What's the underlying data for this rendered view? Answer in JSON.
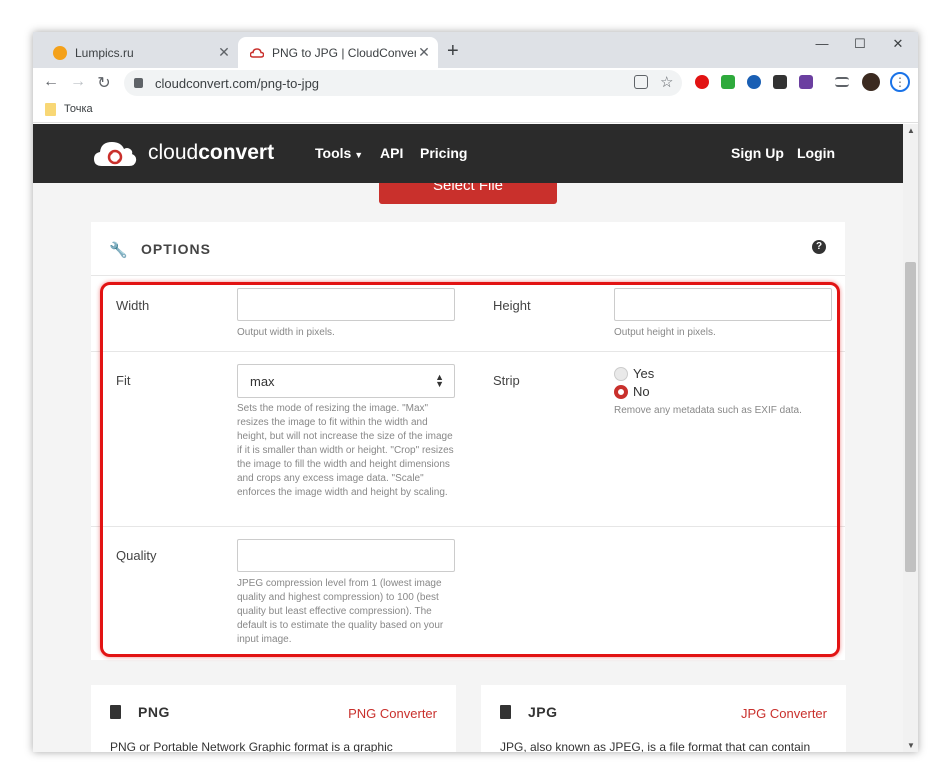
{
  "browser": {
    "tabs": [
      {
        "title": "Lumpics.ru",
        "active": false,
        "favicon_color": "#f4a11a"
      },
      {
        "title": "PNG to JPG | CloudConvert",
        "active": true,
        "favicon_color": "#c9302c"
      }
    ],
    "new_tab": "+",
    "window_controls": {
      "minimize": "—",
      "maximize": "☐",
      "close": "✕"
    },
    "nav": {
      "back": "←",
      "forward": "→",
      "reload": "↻"
    },
    "url": "cloudconvert.com/png-to-jpg",
    "bookmarks": [
      {
        "label": "Точка"
      }
    ]
  },
  "site": {
    "brand_light": "cloud",
    "brand_bold": "convert",
    "nav": {
      "tools": "Tools",
      "api": "API",
      "pricing": "Pricing",
      "signup": "Sign Up",
      "login": "Login"
    },
    "select_file": "Select File"
  },
  "options": {
    "title": "OPTIONS",
    "help": "?",
    "width": {
      "label": "Width",
      "value": "",
      "help": "Output width in pixels."
    },
    "height": {
      "label": "Height",
      "value": "",
      "help": "Output height in pixels."
    },
    "fit": {
      "label": "Fit",
      "value": "max",
      "help": "Sets the mode of resizing the image. \"Max\" resizes the image to fit within the width and height, but will not increase the size of the image if it is smaller than width or height. \"Crop\" resizes the image to fill the width and height dimensions and crops any excess image data. \"Scale\" enforces the image width and height by scaling."
    },
    "strip": {
      "label": "Strip",
      "options": [
        "Yes",
        "No"
      ],
      "selected": "No",
      "help": "Remove any metadata such as EXIF data."
    },
    "quality": {
      "label": "Quality",
      "value": "",
      "help": "JPEG compression level from 1 (lowest image quality and highest compression) to 100 (best quality but least effective compression). The default is to estimate the quality based on your input image."
    }
  },
  "formats": [
    {
      "name": "PNG",
      "link": "PNG Converter",
      "desc": "PNG or Portable Network Graphic format is a graphic"
    },
    {
      "name": "JPG",
      "link": "JPG Converter",
      "desc": "JPG, also known as JPEG, is a file format that can contain"
    }
  ],
  "colors": {
    "accent": "#c9302c",
    "highlight": "#e21313",
    "navbar": "#2b2b2b"
  }
}
